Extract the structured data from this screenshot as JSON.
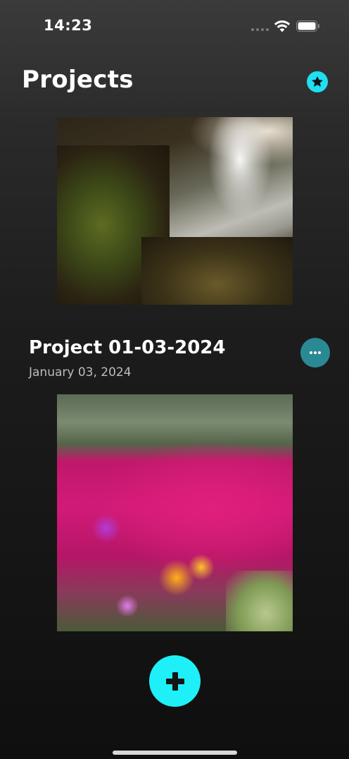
{
  "status_bar": {
    "time": "14:23"
  },
  "header": {
    "title": "Projects",
    "favorites_icon": "star-icon"
  },
  "projects": [
    {
      "name": "",
      "date": "",
      "image": "waterfall-landscape-photo"
    },
    {
      "name": "Project 01-03-2024",
      "date": "January 03, 2024",
      "image": "magenta-flowers-photo",
      "menu_icon": "ellipsis-icon"
    }
  ],
  "fab": {
    "icon": "plus-icon"
  },
  "colors": {
    "accent": "#1ff0f8",
    "menu_button": "#2a8a93",
    "background_top": "#3b3b3b",
    "background_bottom": "#0f0f0f"
  }
}
